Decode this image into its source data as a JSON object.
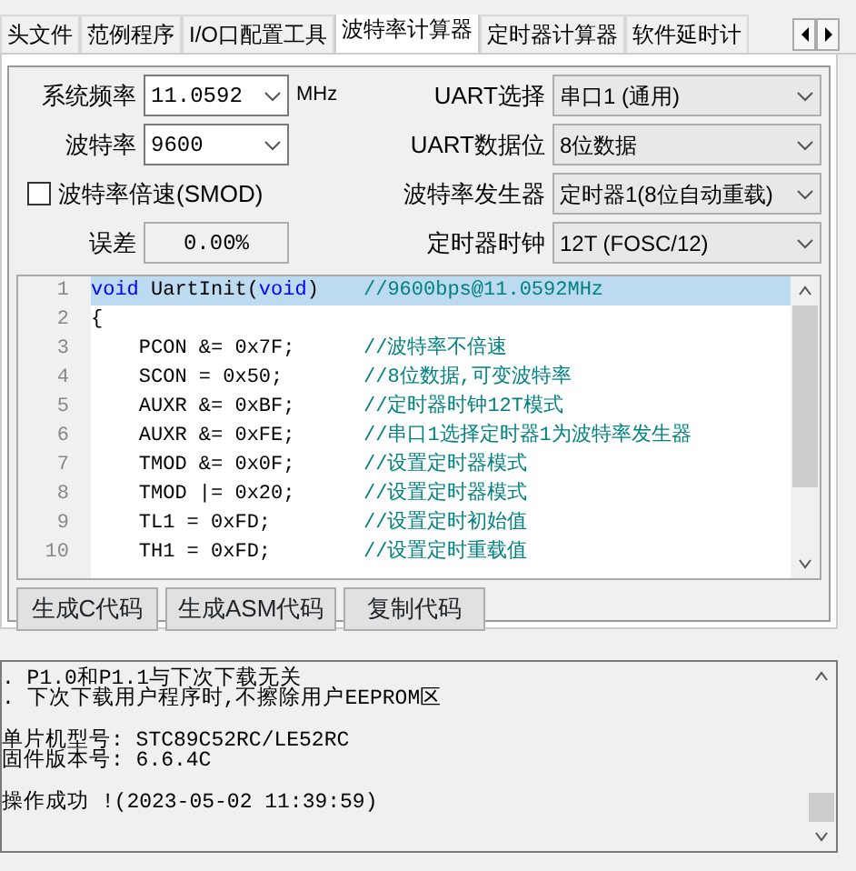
{
  "tabs": [
    {
      "label": "头文件",
      "selected": false
    },
    {
      "label": "范例程序",
      "selected": false
    },
    {
      "label": "I/O口配置工具",
      "selected": false
    },
    {
      "label": "波特率计算器",
      "selected": true
    },
    {
      "label": "定时器计算器",
      "selected": false
    },
    {
      "label": "软件延时计",
      "selected": false
    }
  ],
  "left_fields": [
    {
      "kind": "text",
      "label": "系统频率",
      "value": "11.0592",
      "unit": "MHz"
    },
    {
      "kind": "combo",
      "label": "波特率",
      "value": "9600"
    },
    {
      "kind": "checkbox",
      "label": "波特率倍速(SMOD)",
      "checked": false
    },
    {
      "kind": "readonly",
      "label": "误差",
      "value": "0.00%"
    }
  ],
  "right_fields": [
    {
      "label": "UART选择",
      "value": "串口1 (通用)"
    },
    {
      "label": "UART数据位",
      "value": "8位数据"
    },
    {
      "label": "波特率发生器",
      "value": "定时器1(8位自动重载)"
    },
    {
      "label": "定时器时钟",
      "value": "12T (FOSC/12)"
    }
  ],
  "code_lines": [
    {
      "number": "1",
      "selected": true,
      "tokens": [
        {
          "kind": "keyword",
          "text": "void"
        },
        {
          "kind": "plain",
          "text": " UartInit("
        },
        {
          "kind": "keyword",
          "text": "void"
        },
        {
          "kind": "plain",
          "text": ")"
        }
      ],
      "comment": "//9600bps@11.0592MHz"
    },
    {
      "number": "2",
      "selected": false,
      "tokens": [
        {
          "kind": "plain",
          "text": "{"
        }
      ]
    },
    {
      "number": "3",
      "selected": false,
      "tokens": [
        {
          "kind": "plain",
          "text": "    PCON &= 0x7F;"
        }
      ],
      "comment": "//波特率不倍速"
    },
    {
      "number": "4",
      "selected": false,
      "tokens": [
        {
          "kind": "plain",
          "text": "    SCON = 0x50;"
        }
      ],
      "comment": "//8位数据,可变波特率"
    },
    {
      "number": "5",
      "selected": false,
      "tokens": [
        {
          "kind": "plain",
          "text": "    AUXR &= 0xBF;"
        }
      ],
      "comment": "//定时器时钟12T模式"
    },
    {
      "number": "6",
      "selected": false,
      "tokens": [
        {
          "kind": "plain",
          "text": "    AUXR &= 0xFE;"
        }
      ],
      "comment": "//串口1选择定时器1为波特率发生器"
    },
    {
      "number": "7",
      "selected": false,
      "tokens": [
        {
          "kind": "plain",
          "text": "    TMOD &= 0x0F;"
        }
      ],
      "comment": "//设置定时器模式"
    },
    {
      "number": "8",
      "selected": false,
      "tokens": [
        {
          "kind": "plain",
          "text": "    TMOD |= 0x20;"
        }
      ],
      "comment": "//设置定时器模式"
    },
    {
      "number": "9",
      "selected": false,
      "tokens": [
        {
          "kind": "plain",
          "text": "    TL1 = 0xFD;"
        }
      ],
      "comment": "//设置定时初始值"
    },
    {
      "number": "10",
      "selected": false,
      "tokens": [
        {
          "kind": "plain",
          "text": "    TH1 = 0xFD;"
        }
      ],
      "comment": "//设置定时重载值"
    }
  ],
  "buttons": [
    "生成C代码",
    "生成ASM代码",
    "复制代码"
  ],
  "log_groups": [
    [
      ". P1.0和P1.1与下次下载无关",
      ". 下次下载用户程序时,不擦除用户EEPROM区"
    ],
    [
      "单片机型号: STC89C52RC/LE52RC",
      "固件版本号: 6.6.4C"
    ],
    [
      "操作成功 !(2023-05-02 11:39:59)"
    ]
  ]
}
